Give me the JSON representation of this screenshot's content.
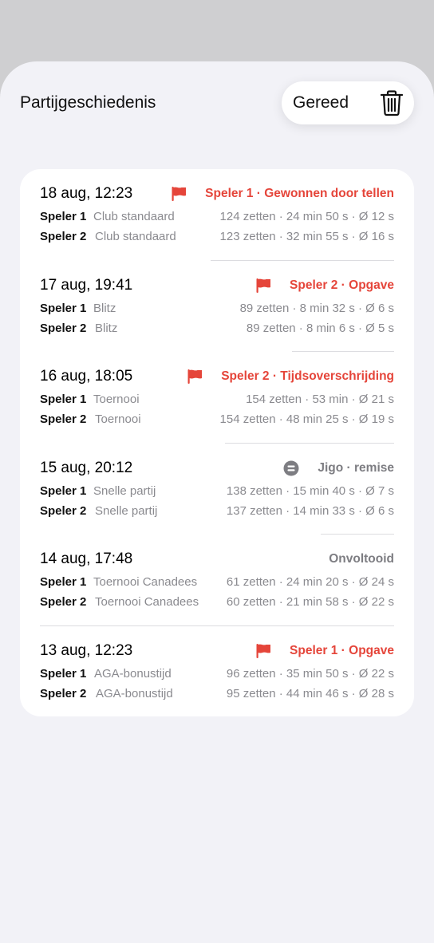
{
  "header": {
    "title": "Partijgeschiedenis",
    "done_label": "Gereed",
    "trash_icon": "trash-icon"
  },
  "colors": {
    "accent_red": "#e5453a",
    "secondary_gray": "#8a8a8f"
  },
  "games": [
    {
      "date": "18 aug, 12:23",
      "status": "Speler 1 · Gewonnen door tellen",
      "status_color": "red",
      "icon": "flag-icon",
      "players": [
        {
          "name": "Speler 1",
          "time_control": "Club standaard",
          "stats": "124 zetten · 24 min 50 s · Ø 12 s"
        },
        {
          "name": "Speler 2",
          "time_control": "Club standaard",
          "stats": "123 zetten · 32 min 55 s · Ø 16 s"
        }
      ]
    },
    {
      "date": "17 aug, 19:41",
      "status": "Speler 2 · Opgave",
      "status_color": "red",
      "icon": "flag-icon",
      "players": [
        {
          "name": "Speler 1",
          "time_control": "Blitz",
          "stats": "89 zetten · 8 min 32 s · Ø 6 s"
        },
        {
          "name": "Speler 2",
          "time_control": "Blitz",
          "stats": "89 zetten · 8 min 6 s · Ø 5 s"
        }
      ]
    },
    {
      "date": "16 aug, 18:05",
      "status": "Speler 2 · Tijdsoverschrijding",
      "status_color": "red",
      "icon": "flag-icon",
      "players": [
        {
          "name": "Speler 1",
          "time_control": "Toernooi",
          "stats": "154 zetten · 53 min · Ø 21 s"
        },
        {
          "name": "Speler 2",
          "time_control": "Toernooi",
          "stats": "154 zetten · 48 min 25 s · Ø 19 s"
        }
      ]
    },
    {
      "date": "15 aug, 20:12",
      "status": "Jigo · remise",
      "status_color": "gray",
      "icon": "equal-circle-icon",
      "players": [
        {
          "name": "Speler 1",
          "time_control": "Snelle partij",
          "stats": "138 zetten · 15 min 40 s · Ø 7 s"
        },
        {
          "name": "Speler 2",
          "time_control": "Snelle partij",
          "stats": "137 zetten · 14 min 33 s · Ø 6 s"
        }
      ]
    },
    {
      "date": "14 aug, 17:48",
      "status": "Onvoltooid",
      "status_color": "gray",
      "icon": "",
      "players": [
        {
          "name": "Speler 1",
          "time_control": "Toernooi Canadees",
          "stats": "61 zetten · 24 min 20 s · Ø 24 s"
        },
        {
          "name": "Speler 2",
          "time_control": "Toernooi Canadees",
          "stats": "60 zetten · 21 min 58 s · Ø 22 s"
        }
      ]
    },
    {
      "date": "13 aug, 12:23",
      "status": "Speler 1 · Opgave",
      "status_color": "red",
      "icon": "flag-icon",
      "players": [
        {
          "name": "Speler 1",
          "time_control": "AGA-bonustijd",
          "stats": "96 zetten · 35 min 50 s · Ø 22 s"
        },
        {
          "name": "Speler 2",
          "time_control": "AGA-bonustijd",
          "stats": "95 zetten · 44 min 46 s · Ø 28 s"
        }
      ]
    }
  ]
}
